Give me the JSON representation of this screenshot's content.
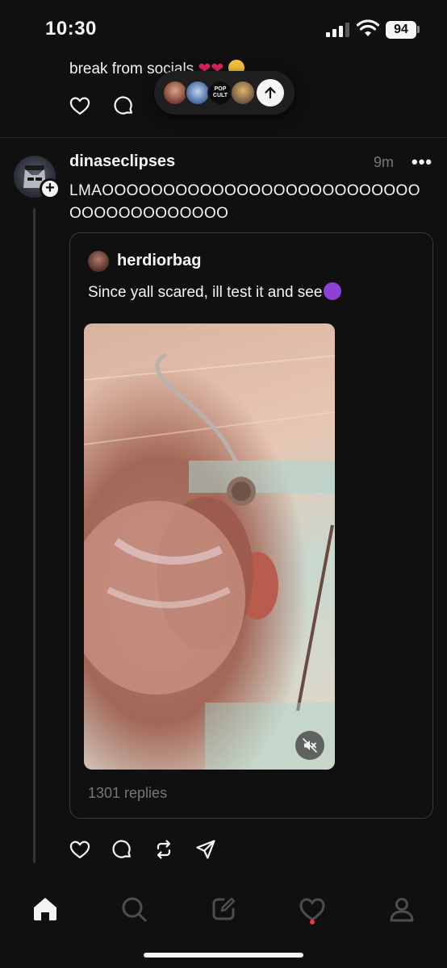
{
  "status_bar": {
    "time": "10:30",
    "battery": "94"
  },
  "previous_post": {
    "text": "break from socials"
  },
  "new_posts_pill": {
    "badge_text": "POP CULT"
  },
  "post": {
    "username": "dinaseclipses",
    "time_ago": "9m",
    "more": "•••",
    "text": "LMAOOOOOOOOOOOOOOOOOOOOOOOOOOOOOOOOOOOOOOO",
    "quoted": {
      "username": "herdiorbag",
      "text": "Since yall scared, ill test it and see",
      "replies": "1301 replies"
    }
  },
  "icons": {
    "like": "heart-icon",
    "reply": "comment-icon",
    "repost": "repost-icon",
    "share": "send-icon",
    "tabs": [
      "home-icon",
      "search-icon",
      "compose-icon",
      "activity-heart-icon",
      "profile-icon"
    ]
  },
  "colors": {
    "background": "#101010",
    "text": "#f3f5f7",
    "muted": "#777777",
    "notification_dot": "#ff3040"
  }
}
